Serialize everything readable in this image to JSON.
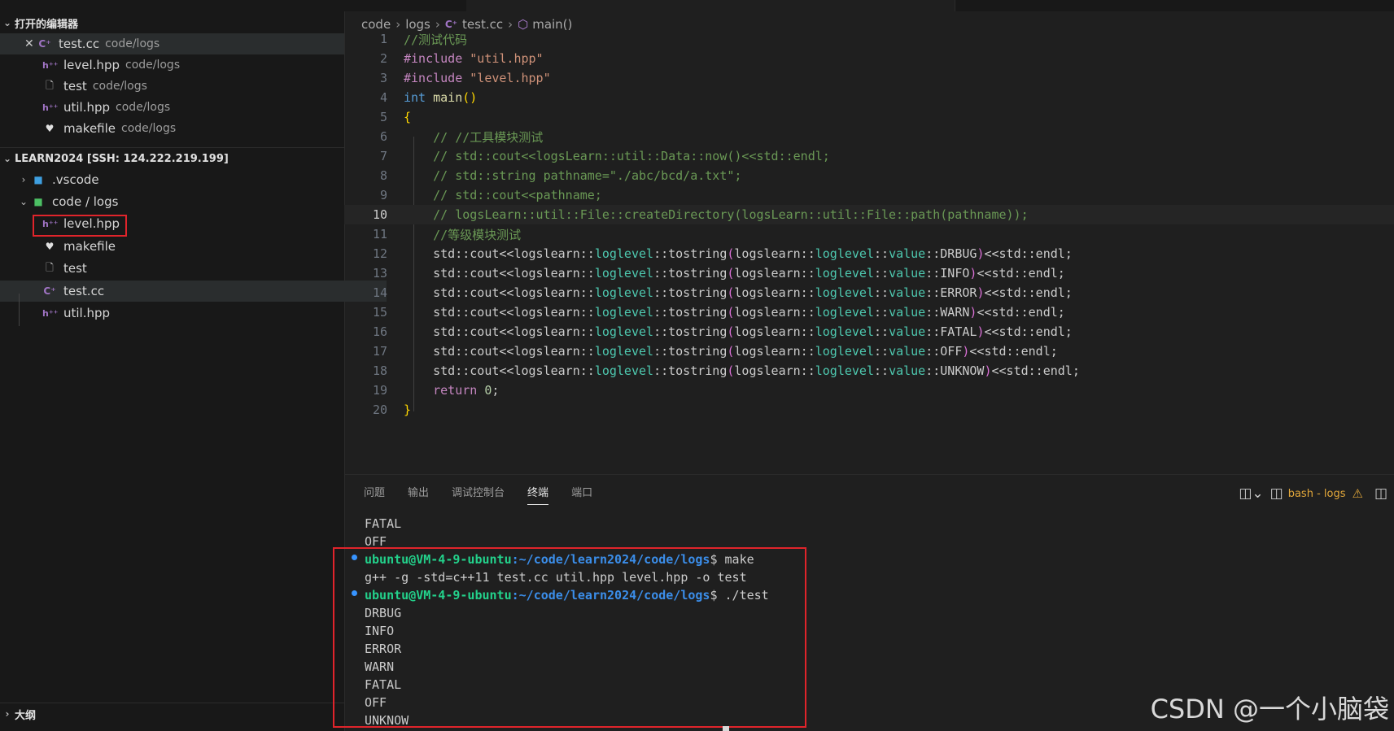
{
  "sidebar": {
    "open_editors": {
      "title": "打开的编辑器",
      "items": [
        {
          "name": "test.cc",
          "desc": "code/logs",
          "icon": "cpp-file-icon"
        },
        {
          "name": "level.hpp",
          "desc": "code/logs",
          "icon": "hpp-file-icon"
        },
        {
          "name": "test",
          "desc": "code/logs",
          "icon": "file-icon"
        },
        {
          "name": "util.hpp",
          "desc": "code/logs",
          "icon": "hpp-file-icon"
        },
        {
          "name": "makefile",
          "desc": "code/logs",
          "icon": "makefile-icon"
        }
      ]
    },
    "workspace": {
      "title": "LEARN2024 [SSH: 124.222.219.199]",
      "folders": [
        {
          "name": ".vscode",
          "icon": "vscode-folder-icon"
        },
        {
          "name": "code / logs",
          "icon": "folder-icon"
        }
      ],
      "files": [
        {
          "name": "level.hpp",
          "icon": "hpp-file-icon"
        },
        {
          "name": "makefile",
          "icon": "makefile-icon"
        },
        {
          "name": "test",
          "icon": "file-icon"
        },
        {
          "name": "test.cc",
          "icon": "cpp-file-icon"
        },
        {
          "name": "util.hpp",
          "icon": "hpp-file-icon"
        }
      ]
    },
    "outline_title": "大纲"
  },
  "breadcrumb": [
    "code",
    "logs",
    "test.cc",
    "main()"
  ],
  "editor": {
    "line_numbers": [
      "1",
      "2",
      "3",
      "4",
      "5",
      "6",
      "7",
      "8",
      "9",
      "10",
      "11",
      "12",
      "13",
      "14",
      "15",
      "16",
      "17",
      "18",
      "19",
      "20"
    ],
    "current_line": "10"
  },
  "panel": {
    "tabs": [
      "问题",
      "输出",
      "调试控制台",
      "终端",
      "端口"
    ],
    "active_tab": "终端",
    "terminal_label": "bash - logs"
  },
  "terminal": {
    "pre": [
      "FATAL",
      "OFF"
    ],
    "user": "ubuntu@VM-4-9-ubuntu",
    "path": ":~/code/learn2024/code/logs",
    "cmd1": "$ make",
    "compile": "g++ -g -std=c++11 test.cc util.hpp level.hpp -o test",
    "cmd2": "$ ./test",
    "output": [
      "DRBUG",
      "INFO",
      "ERROR",
      "WARN",
      "FATAL",
      "OFF",
      "UNKNOW"
    ]
  },
  "watermark": "CSDN @一个小脑袋",
  "colors": {
    "accent_red": "#e0242b",
    "prompt_green": "#23d18b",
    "prompt_blue": "#3b8eea",
    "warning": "#e2a73a"
  }
}
